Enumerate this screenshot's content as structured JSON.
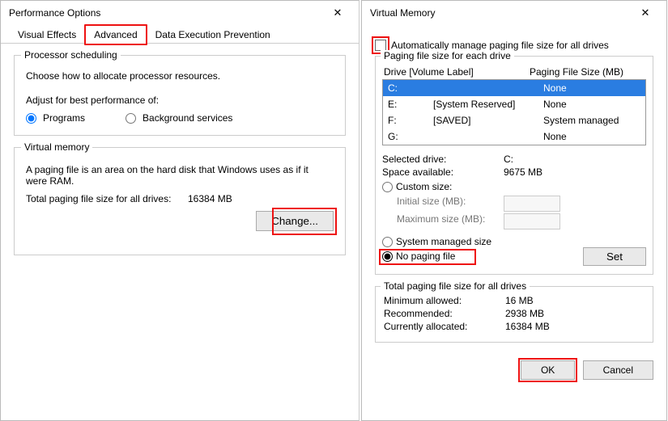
{
  "leftWindow": {
    "title": "Performance Options",
    "tabs": [
      "Visual Effects",
      "Advanced",
      "Data Execution Prevention"
    ],
    "activeTabIndex": 1,
    "processorScheduling": {
      "legend": "Processor scheduling",
      "desc": "Choose how to allocate processor resources.",
      "adjustLabel": "Adjust for best performance of:",
      "radioPrograms": "Programs",
      "radioBackground": "Background services"
    },
    "virtualMemory": {
      "legend": "Virtual memory",
      "desc": "A paging file is an area on the hard disk that Windows uses as if it were RAM.",
      "totalLabel": "Total paging file size for all drives:",
      "totalValue": "16384 MB",
      "changeButton": "Change..."
    }
  },
  "rightWindow": {
    "title": "Virtual Memory",
    "autoManageLabel": "Automatically manage paging file size for all drives",
    "driveGroupLegend": "Paging file size for each drive",
    "driveHeader": {
      "col1": "Drive  [Volume Label]",
      "col2": "Paging File Size (MB)"
    },
    "drives": [
      {
        "letter": "C:",
        "label": "",
        "size": "None",
        "selected": true
      },
      {
        "letter": "E:",
        "label": "[System Reserved]",
        "size": "None",
        "selected": false
      },
      {
        "letter": "F:",
        "label": "[SAVED]",
        "size": "System managed",
        "selected": false
      },
      {
        "letter": "G:",
        "label": "",
        "size": "None",
        "selected": false
      }
    ],
    "selectedDriveLabel": "Selected drive:",
    "selectedDriveValue": "C:",
    "spaceAvailLabel": "Space available:",
    "spaceAvailValue": "9675 MB",
    "customSizeLabel": "Custom size:",
    "initialSizeLabel": "Initial size (MB):",
    "maximumSizeLabel": "Maximum size (MB):",
    "sysManagedLabel": "System managed size",
    "noPagingLabel": "No paging file",
    "setButton": "Set",
    "totalsLegend": "Total paging file size for all drives",
    "minAllowedLabel": "Minimum allowed:",
    "minAllowedValue": "16 MB",
    "recommendedLabel": "Recommended:",
    "recommendedValue": "2938 MB",
    "currentAllocLabel": "Currently allocated:",
    "currentAllocValue": "16384 MB",
    "okButton": "OK",
    "cancelButton": "Cancel"
  }
}
